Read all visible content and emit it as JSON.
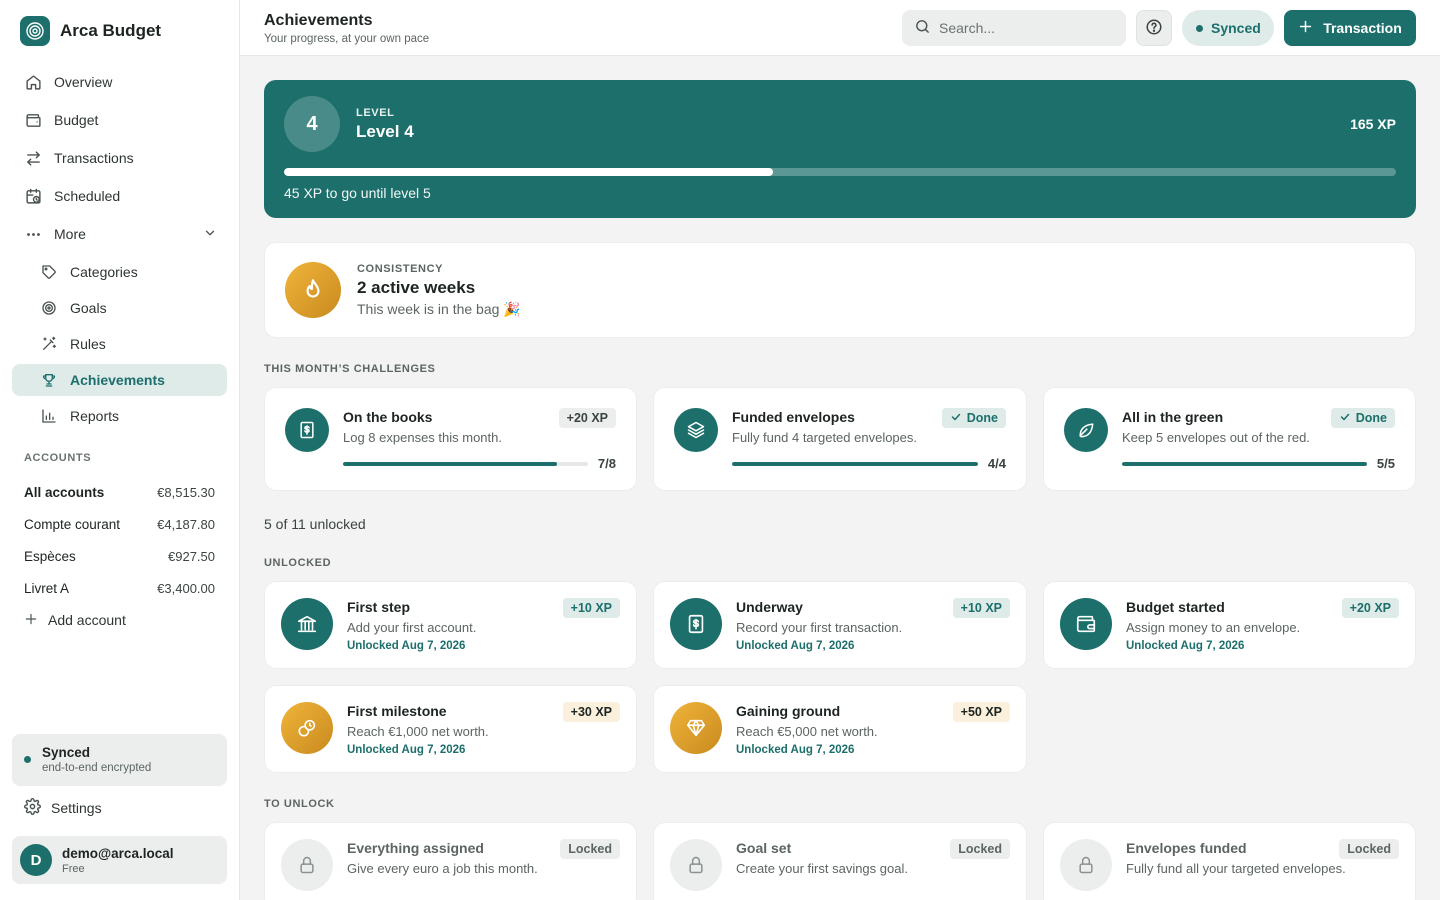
{
  "app": {
    "name": "Arca Budget"
  },
  "nav": {
    "overview": "Overview",
    "budget": "Budget",
    "transactions": "Transactions",
    "scheduled": "Scheduled",
    "more": "More",
    "categories": "Categories",
    "goals": "Goals",
    "rules": "Rules",
    "achievements": "Achievements",
    "reports": "Reports"
  },
  "accounts": {
    "heading": "ACCOUNTS",
    "items": [
      {
        "name": "All accounts",
        "amount": "€8,515.30"
      },
      {
        "name": "Compte courant",
        "amount": "€4,187.80"
      },
      {
        "name": "Espèces",
        "amount": "€927.50"
      },
      {
        "name": "Livret A",
        "amount": "€3,400.00"
      }
    ],
    "add_label": "Add account"
  },
  "sync": {
    "title": "Synced",
    "subtitle": "end-to-end encrypted"
  },
  "settings_label": "Settings",
  "user": {
    "initial": "D",
    "email": "demo@arca.local",
    "plan": "Free"
  },
  "header": {
    "title": "Achievements",
    "subtitle": "Your progress, at your own pace",
    "search_placeholder": "Search...",
    "synced_label": "Synced",
    "transaction_label": "Transaction"
  },
  "level": {
    "number": "4",
    "kicker": "LEVEL",
    "name": "Level 4",
    "xp": "165 XP",
    "progress": 0.44,
    "to_go": "45 XP to go until level 5"
  },
  "streak": {
    "kicker": "CONSISTENCY",
    "title": "2 active weeks",
    "subtitle": "This week is in the bag 🎉"
  },
  "challenges": {
    "heading": "THIS MONTH’S CHALLENGES",
    "items": [
      {
        "title": "On the books",
        "desc": "Log 8 expenses this month.",
        "badge": "+20 XP",
        "done": false,
        "progress": 0.875,
        "count": "7/8",
        "icon": "receipt-icon"
      },
      {
        "title": "Funded envelopes",
        "desc": "Fully fund 4 targeted envelopes.",
        "badge": "Done",
        "done": true,
        "progress": 1.0,
        "count": "4/4",
        "icon": "layers-icon"
      },
      {
        "title": "All in the green",
        "desc": "Keep 5 envelopes out of the red.",
        "badge": "Done",
        "done": true,
        "progress": 1.0,
        "count": "5/5",
        "icon": "leaf-icon"
      }
    ]
  },
  "unlocked_summary": "5 of 11 unlocked",
  "unlocked": {
    "heading": "UNLOCKED",
    "items": [
      {
        "title": "First step",
        "desc": "Add your first account.",
        "date": "Unlocked Aug 7, 2026",
        "badge": "+10 XP",
        "icon": "bank-icon",
        "tier": "teal"
      },
      {
        "title": "Underway",
        "desc": "Record your first transaction.",
        "date": "Unlocked Aug 7, 2026",
        "badge": "+10 XP",
        "icon": "receipt-icon",
        "tier": "teal"
      },
      {
        "title": "Budget started",
        "desc": "Assign money to an envelope.",
        "date": "Unlocked Aug 7, 2026",
        "badge": "+20 XP",
        "icon": "wallet-icon",
        "tier": "teal"
      },
      {
        "title": "First milestone",
        "desc": "Reach €1,000 net worth.",
        "date": "Unlocked Aug 7, 2026",
        "badge": "+30 XP",
        "icon": "coins-icon",
        "tier": "gold"
      },
      {
        "title": "Gaining ground",
        "desc": "Reach €5,000 net worth.",
        "date": "Unlocked Aug 7, 2026",
        "badge": "+50 XP",
        "icon": "gem-icon",
        "tier": "gold"
      }
    ]
  },
  "locked": {
    "heading": "TO UNLOCK",
    "items": [
      {
        "title": "Everything assigned",
        "desc": "Give every euro a job this month.",
        "badge": "Locked",
        "icon": "lock-icon"
      },
      {
        "title": "Goal set",
        "desc": "Create your first savings goal.",
        "badge": "Locked",
        "icon": "lock-icon"
      },
      {
        "title": "Envelopes funded",
        "desc": "Fully fund all your targeted envelopes.",
        "badge": "Locked",
        "icon": "lock-icon"
      }
    ]
  },
  "colors": {
    "accent": "#1c6f6b",
    "accent_soft": "#deebe9",
    "gold": "#e0a22e",
    "background": "#f2f3f2"
  }
}
